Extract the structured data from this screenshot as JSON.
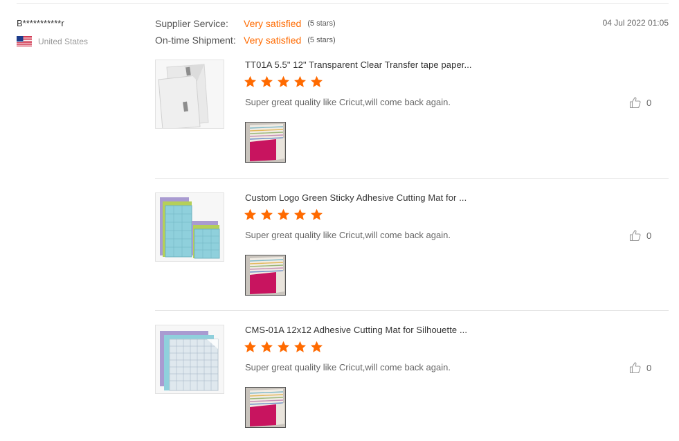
{
  "reviewer": {
    "name": "B***********r",
    "country": "United States"
  },
  "ratings": [
    {
      "label": "Supplier Service:",
      "value": "Very satisfied",
      "stars": "(5 stars)"
    },
    {
      "label": "On-time Shipment:",
      "value": "Very satisfied",
      "stars": "(5 stars)"
    }
  ],
  "date": "04 Jul 2022 01:05",
  "items": [
    {
      "title": "TT01A 5.5\" 12\" Transparent Clear Transfer tape paper...",
      "rating": 5,
      "comment": "Super great quality like Cricut,will come back again.",
      "likes": "0"
    },
    {
      "title": "Custom Logo Green Sticky Adhesive Cutting Mat for ...",
      "rating": 5,
      "comment": "Super great quality like Cricut,will come back again.",
      "likes": "0"
    },
    {
      "title": "CMS-01A 12x12 Adhesive Cutting Mat for Silhouette ...",
      "rating": 5,
      "comment": "Super great quality like Cricut,will come back again.",
      "likes": "0"
    }
  ],
  "colors": {
    "accent": "#ff6a00",
    "star": "#ff6a00",
    "divider": "#e6e6e6"
  },
  "icons": {
    "flag": "us-flag-icon",
    "star": "star-icon",
    "like": "thumbs-up-icon"
  }
}
